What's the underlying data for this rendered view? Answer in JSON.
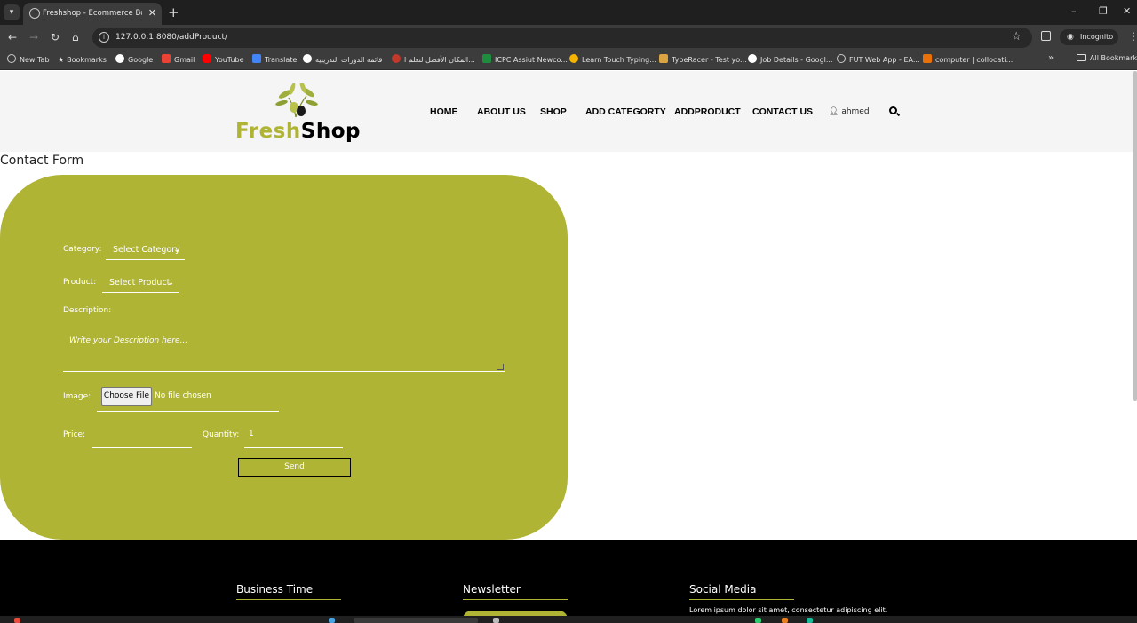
{
  "browser": {
    "tab_title": "Freshshop - Ecommerce Bootstrap",
    "url": "127.0.0.1:8080/addProduct/",
    "incognito_label": "Incognito",
    "bookmarks": [
      "New Tab",
      "Bookmarks",
      "Google",
      "Gmail",
      "YouTube",
      "Translate",
      "قائمة الدورات التدريبية",
      "المكان الأفضل لتعلم ا...",
      "ICPC Assiut Newco...",
      "Learn Touch Typing...",
      "TypeRacer - Test yo...",
      "Job Details - Googl...",
      "FUT Web App - EA...",
      "computer | collocati..."
    ],
    "all_bookmarks_label": "All Bookmarks"
  },
  "header": {
    "logo_fresh": "Fresh",
    "logo_shop": "Shop",
    "nav": [
      "HOME",
      "ABOUT US",
      "SHOP",
      "ADD CATEGORTY",
      "ADDPRODUCT",
      "CONTACT US"
    ],
    "user": "ahmed"
  },
  "form": {
    "title": "Contact Form",
    "category_label": "Category:",
    "category_value": "Select Category",
    "product_label": "Product:",
    "product_value": "Select Product",
    "description_label": "Description:",
    "description_placeholder": "Write your Description here...",
    "image_label": "Image:",
    "file_button": "Choose File",
    "file_status": "No file chosen",
    "price_label": "Price:",
    "price_value": "",
    "quantity_label": "Quantity:",
    "quantity_value": "1",
    "send_label": "Send"
  },
  "footer": {
    "business_time": "Business Time",
    "newsletter": "Newsletter",
    "social_media": "Social Media",
    "social_text": "Lorem ipsum dolor sit amet, consectetur adipiscing elit."
  },
  "colors": {
    "accent": "#b0b435",
    "footer_bg": "#000000",
    "header_bg": "#f5f5f5"
  }
}
